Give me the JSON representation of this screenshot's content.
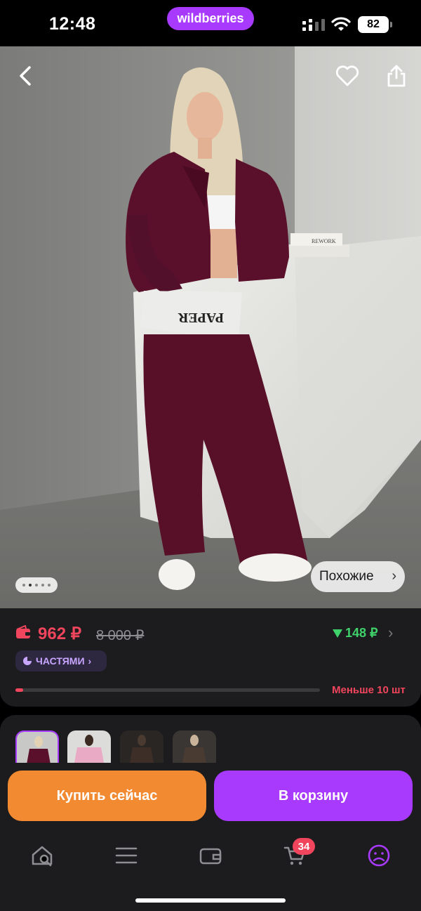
{
  "status_bar": {
    "time": "12:48",
    "brand": "wildberries",
    "battery": "82"
  },
  "photo": {
    "newspaper_text": "PAPER",
    "book_text": "REWORK",
    "similar_label": "Похожие",
    "gallery_dots": 5,
    "gallery_active_index": 1
  },
  "price": {
    "current": "962 ₽",
    "old": "8 000 ₽",
    "cashback": "148 ₽",
    "parts_label": "ЧАСТЯМИ",
    "stock_text": "Меньше 10 шт",
    "stock_fraction": 0.025
  },
  "actions": {
    "buy_now": "Купить сейчас",
    "add_to_cart": "В корзину"
  },
  "tabbar": {
    "cart_badge": "34",
    "items": [
      "home-search-icon",
      "catalog-icon",
      "wallet-icon",
      "cart-icon",
      "profile-icon"
    ]
  },
  "colors": {
    "accent": "#a73afd",
    "price": "#f0455c",
    "cashback": "#3fd26a",
    "buy": "#f28a32"
  }
}
